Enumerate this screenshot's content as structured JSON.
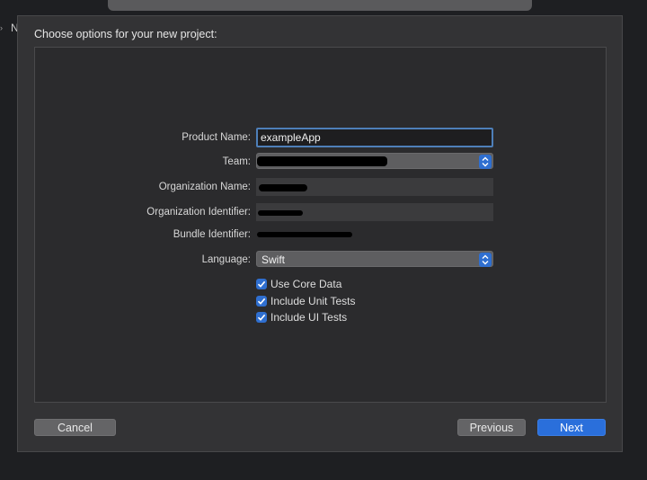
{
  "edge": {
    "letter": "N",
    "chevron": "›"
  },
  "sheet": {
    "title": "Choose options for your new project:"
  },
  "form": {
    "product_name": {
      "label": "Product Name:",
      "value": "exampleApp"
    },
    "team": {
      "label": "Team:"
    },
    "organization_name": {
      "label": "Organization Name:"
    },
    "organization_identifier": {
      "label": "Organization Identifier:"
    },
    "bundle_identifier": {
      "label": "Bundle Identifier:"
    },
    "language": {
      "label": "Language:",
      "value": "Swift"
    },
    "checkboxes": [
      {
        "label": "Use Core Data",
        "checked": true
      },
      {
        "label": "Include Unit Tests",
        "checked": true
      },
      {
        "label": "Include UI Tests",
        "checked": true
      }
    ]
  },
  "buttons": {
    "cancel": "Cancel",
    "previous": "Previous",
    "next": "Next"
  },
  "colors": {
    "accent": "#2a6fdb",
    "focus_ring": "#4e7fb9",
    "sheet_bg": "#333335",
    "panel_bg": "#2b2b2d"
  }
}
